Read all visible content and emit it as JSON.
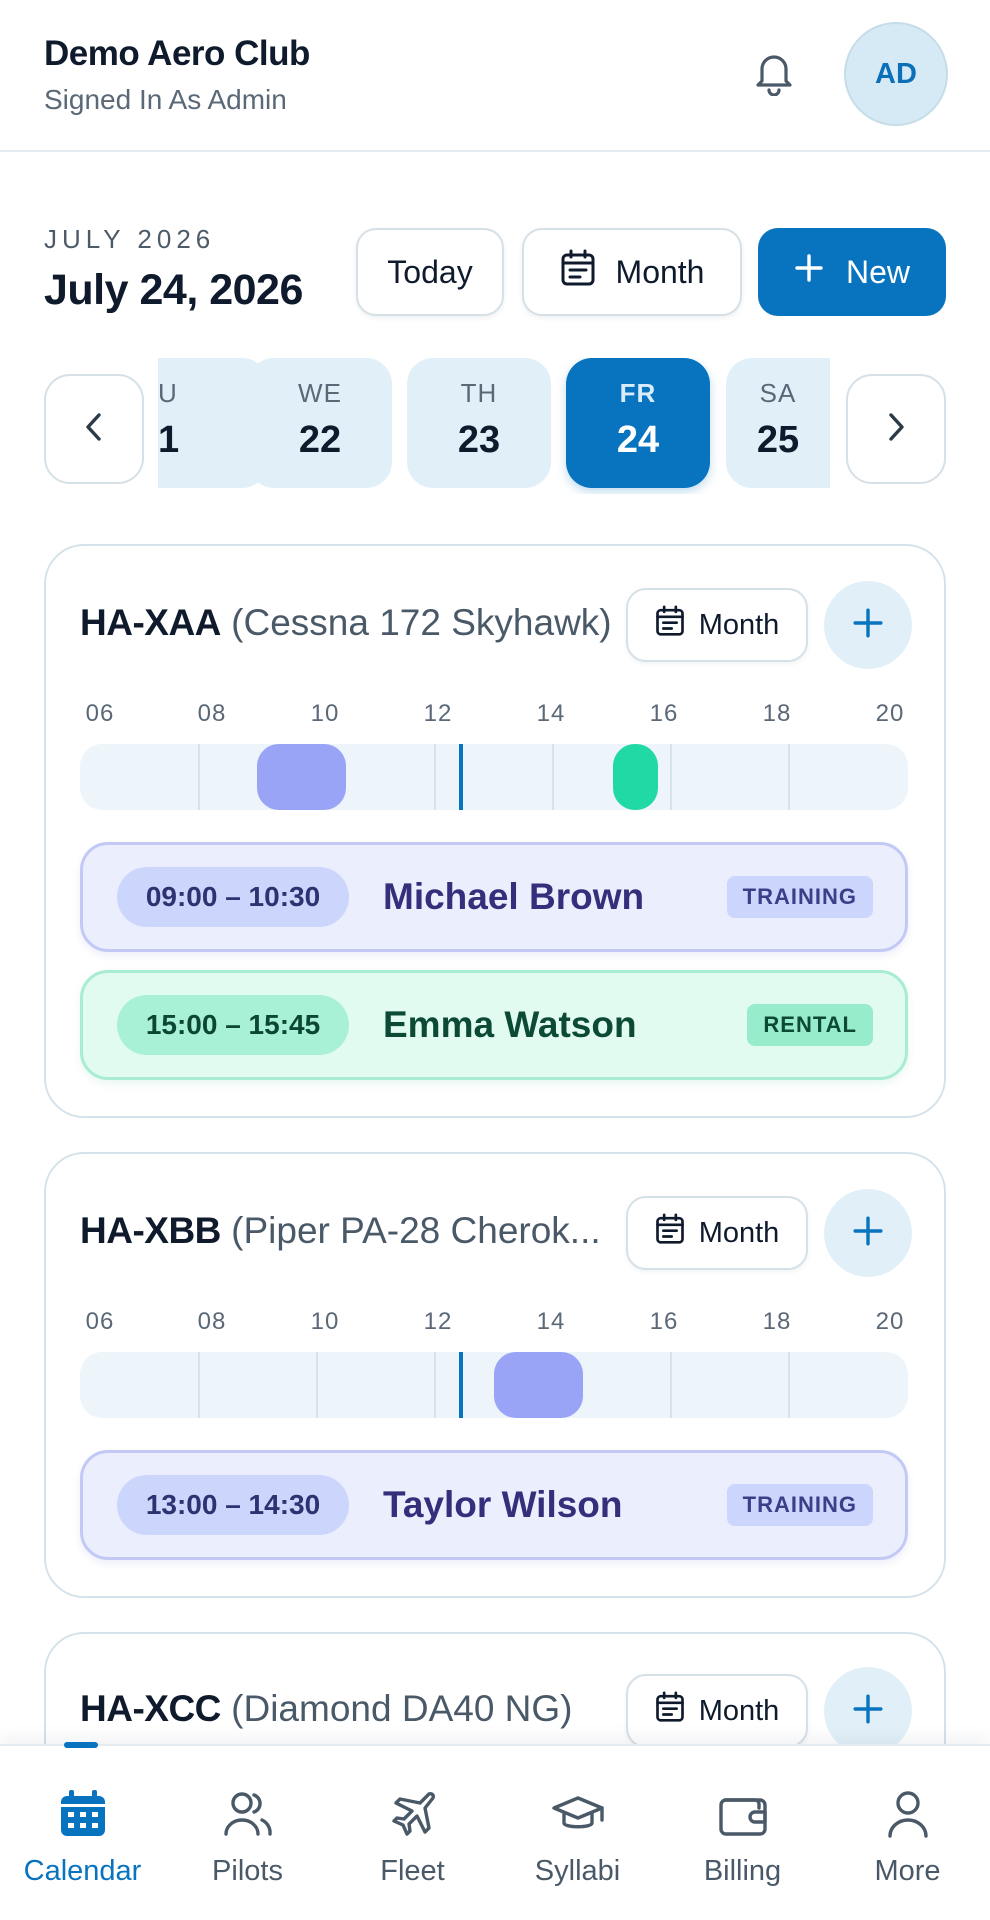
{
  "header": {
    "club_name": "Demo Aero Club",
    "subtitle": "Signed In As Admin",
    "avatar_initials": "AD"
  },
  "date_bar": {
    "month_kicker": "JULY 2026",
    "date_title": "July 24, 2026",
    "today_label": "Today",
    "month_label": "Month",
    "new_label": "New"
  },
  "days": [
    {
      "dow": "U",
      "num": "1"
    },
    {
      "dow": "WE",
      "num": "22"
    },
    {
      "dow": "TH",
      "num": "23"
    },
    {
      "dow": "FR",
      "num": "24",
      "selected": true
    },
    {
      "dow": "SA",
      "num": "25"
    }
  ],
  "hour_labels": [
    "06",
    "08",
    "10",
    "12",
    "14",
    "16",
    "18",
    "20"
  ],
  "aircraft": [
    {
      "reg": "HA-XAA",
      "model": "(Cessna 172 Skyhawk)",
      "month_label": "Month",
      "bookings": [
        {
          "time": "09:00 – 10:30",
          "name": "Michael Brown",
          "tag": "TRAINING",
          "type": "training"
        },
        {
          "time": "15:00 – 15:45",
          "name": "Emma Watson",
          "tag": "RENTAL",
          "type": "rental"
        }
      ]
    },
    {
      "reg": "HA-XBB",
      "model": "(Piper PA-28 Cherok...",
      "month_label": "Month",
      "bookings": [
        {
          "time": "13:00 – 14:30",
          "name": "Taylor Wilson",
          "tag": "TRAINING",
          "type": "training"
        }
      ]
    },
    {
      "reg": "HA-XCC",
      "model": "(Diamond DA40 NG)",
      "month_label": "Month"
    }
  ],
  "bottom_nav": [
    {
      "label": "Calendar",
      "icon": "calendar-icon",
      "active": true
    },
    {
      "label": "Pilots",
      "icon": "users-icon"
    },
    {
      "label": "Fleet",
      "icon": "plane-icon"
    },
    {
      "label": "Syllabi",
      "icon": "graduation-cap-icon"
    },
    {
      "label": "Billing",
      "icon": "wallet-icon"
    },
    {
      "label": "More",
      "icon": "person-icon"
    }
  ],
  "colors": {
    "accent": "#0873bf",
    "training": "#99a4f6",
    "rental": "#21d9a2"
  }
}
